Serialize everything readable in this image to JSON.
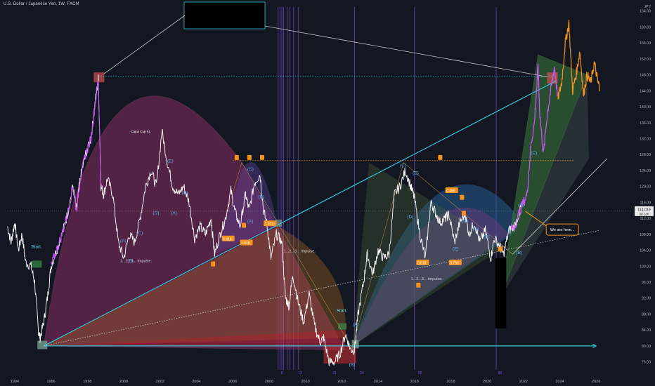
{
  "header": {
    "symbol": "U.S. Dollar / Japanese Yen, 1W, FXCM"
  },
  "currency_label": "JPY",
  "colors": {
    "background": "#131722",
    "price": "#ffffff",
    "projection_orange": "#f7931a",
    "projection_purple": "#c030ff",
    "cyan": "#36c5d6",
    "last_price_badge": "#e8e8e8"
  },
  "chart_data": {
    "type": "line",
    "xlim": [
      1993.5,
      2028.0
    ],
    "ylim": [
      74,
      165
    ],
    "y_ticks": [
      76,
      80,
      84,
      88,
      92,
      96,
      100,
      104,
      108,
      112,
      116,
      120,
      124,
      128,
      132,
      136,
      140,
      144,
      148,
      152,
      156,
      160,
      164
    ],
    "x_ticks": [
      1994,
      1996,
      1998,
      2000,
      2002,
      2004,
      2006,
      2008,
      2010,
      2012,
      2014,
      2016,
      2018,
      2020,
      2022,
      2024,
      2026
    ],
    "last_price": "114.019",
    "countdown": "3d 13h",
    "series": [
      {
        "values": [
          [
            1993.6,
            110
          ],
          [
            1993.8,
            106
          ],
          [
            1994.0,
            111
          ],
          [
            1994.2,
            104
          ],
          [
            1994.4,
            108
          ],
          [
            1994.6,
            101
          ],
          [
            1994.9,
            100
          ],
          [
            1995.1,
            96
          ],
          [
            1995.3,
            84
          ],
          [
            1995.4,
            82
          ],
          [
            1995.6,
            86
          ],
          [
            1995.8,
            92
          ],
          [
            1996.0,
            100
          ],
          [
            1996.3,
            104
          ],
          [
            1996.6,
            108
          ],
          [
            1996.9,
            113
          ],
          [
            1997.2,
            120
          ],
          [
            1997.4,
            114
          ],
          [
            1997.6,
            122
          ],
          [
            1997.9,
            128
          ],
          [
            1998.2,
            132
          ],
          [
            1998.4,
            140
          ],
          [
            1998.6,
            147
          ],
          [
            1998.75,
            120
          ],
          [
            1998.9,
            118
          ],
          [
            1999.1,
            122
          ],
          [
            1999.4,
            118
          ],
          [
            1999.7,
            106
          ],
          [
            2000.0,
            102
          ],
          [
            2000.3,
            108
          ],
          [
            2000.6,
            106
          ],
          [
            2000.9,
            112
          ],
          [
            2001.2,
            120
          ],
          [
            2001.5,
            124
          ],
          [
            2001.8,
            120
          ],
          [
            2002.1,
            134
          ],
          [
            2002.4,
            126
          ],
          [
            2002.7,
            120
          ],
          [
            2003.0,
            118
          ],
          [
            2003.3,
            120
          ],
          [
            2003.6,
            116
          ],
          [
            2003.9,
            107
          ],
          [
            2004.2,
            110
          ],
          [
            2004.5,
            108
          ],
          [
            2004.8,
            112
          ],
          [
            2005.0,
            103
          ],
          [
            2005.3,
            108
          ],
          [
            2005.6,
            112
          ],
          [
            2005.9,
            119
          ],
          [
            2006.1,
            114
          ],
          [
            2006.4,
            110
          ],
          [
            2006.7,
            118
          ],
          [
            2006.9,
            114
          ],
          [
            2007.2,
            121
          ],
          [
            2007.5,
            123
          ],
          [
            2007.7,
            114
          ],
          [
            2007.9,
            110
          ],
          [
            2008.1,
            102
          ],
          [
            2008.4,
            108
          ],
          [
            2008.7,
            106
          ],
          [
            2008.9,
            92
          ],
          [
            2009.1,
            90
          ],
          [
            2009.3,
            98
          ],
          [
            2009.6,
            91
          ],
          [
            2009.9,
            86
          ],
          [
            2010.2,
            93
          ],
          [
            2010.5,
            85
          ],
          [
            2010.8,
            81
          ],
          [
            2011.0,
            82
          ],
          [
            2011.3,
            76
          ],
          [
            2011.6,
            76
          ],
          [
            2011.9,
            78
          ],
          [
            2012.2,
            83
          ],
          [
            2012.5,
            79
          ],
          [
            2012.7,
            79
          ],
          [
            2012.9,
            88
          ],
          [
            2013.2,
            96
          ],
          [
            2013.4,
            103
          ],
          [
            2013.7,
            98
          ],
          [
            2014.0,
            104
          ],
          [
            2014.3,
            102
          ],
          [
            2014.6,
            103
          ],
          [
            2014.9,
            118
          ],
          [
            2015.2,
            120
          ],
          [
            2015.5,
            124
          ],
          [
            2015.8,
            120
          ],
          [
            2016.0,
            117
          ],
          [
            2016.3,
            108
          ],
          [
            2016.6,
            102
          ],
          [
            2016.9,
            116
          ],
          [
            2017.1,
            114
          ],
          [
            2017.4,
            111
          ],
          [
            2017.7,
            112
          ],
          [
            2017.9,
            113
          ],
          [
            2018.2,
            106
          ],
          [
            2018.5,
            111
          ],
          [
            2018.8,
            113
          ],
          [
            2019.0,
            108
          ],
          [
            2019.3,
            111
          ],
          [
            2019.6,
            106
          ],
          [
            2019.9,
            109
          ],
          [
            2020.2,
            102
          ],
          [
            2020.4,
            107
          ],
          [
            2020.7,
            105
          ],
          [
            2020.9,
            103
          ],
          [
            2021.2,
            109
          ],
          [
            2021.5,
            110
          ],
          [
            2021.9,
            115
          ],
          [
            2022.2,
            118
          ],
          [
            2022.4,
            130
          ],
          [
            2022.6,
            136
          ],
          [
            2022.8,
            150
          ],
          [
            2022.9,
            138
          ],
          [
            2023.1,
            128
          ],
          [
            2023.3,
            138
          ],
          [
            2023.5,
            144
          ],
          [
            2023.7,
            150
          ],
          [
            2023.9,
            142
          ],
          [
            2024.1,
            146
          ],
          [
            2024.3,
            156
          ],
          [
            2024.5,
            161
          ],
          [
            2024.7,
            144
          ],
          [
            2024.9,
            148
          ],
          [
            2025.1,
            154
          ],
          [
            2025.3,
            143
          ],
          [
            2025.5,
            148
          ],
          [
            2025.7,
            146
          ],
          [
            2025.9,
            151
          ],
          [
            2026.1,
            146
          ],
          [
            2026.2,
            145
          ]
        ]
      }
    ]
  },
  "annotations": {
    "start_labels": [
      "Start.",
      "Start."
    ],
    "wave_labels": [
      "(A)",
      "(B)",
      "(C)",
      "(D)",
      "(E)",
      "(A)",
      "(B)",
      "(C)",
      "(A)",
      "(B)",
      "(C)",
      "(D)",
      "(E)",
      "(A)",
      "(B)",
      "(C)",
      "(C)",
      "(D)",
      "(E)",
      "(B)",
      "(A)",
      "(B)"
    ],
    "impulse_labels": [
      "1...2...3... Impulse.",
      "1...2...3... Impulse.",
      "1...2...3... Impulse."
    ],
    "cup_label": "Cajun Cup #1",
    "fib_labels": [
      "0.618",
      "1.618",
      "1.073",
      "0.456",
      "0.618",
      "0.786"
    ],
    "callout": "We are here...",
    "cycle_numbers": [
      "8",
      "13",
      "21",
      "34",
      "55",
      "89"
    ]
  }
}
